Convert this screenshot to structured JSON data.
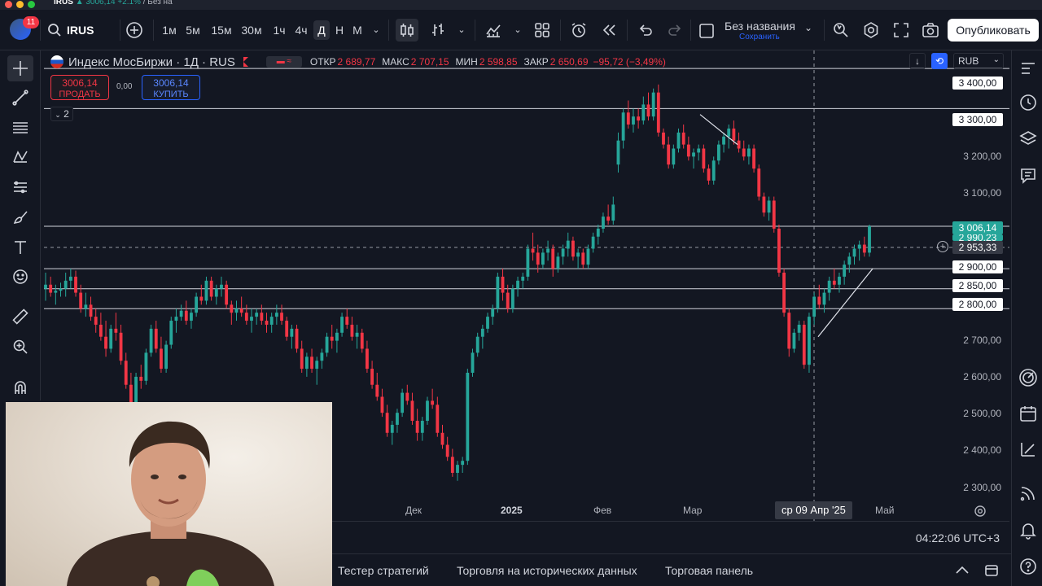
{
  "window": {
    "tab_symbol": "IRUS",
    "tab_price": "3006,14",
    "tab_change": "+2.1%",
    "tab_suffix": "/ Без на"
  },
  "toolbar": {
    "symbol": "IRUS",
    "notifications": "11",
    "intervals": [
      "1м",
      "5м",
      "15м",
      "30м",
      "1ч",
      "4ч",
      "Д",
      "Н",
      "М"
    ],
    "active_interval": "Д",
    "layout_name": "Без названия",
    "layout_save": "Сохранить",
    "publish_label": "Опубликовать"
  },
  "legend": {
    "name": "Индекс МосБиржи · 1Д · RUS",
    "open_label": "ОТКР",
    "open": "2 689,77",
    "high_label": "МАКС",
    "high": "2 707,15",
    "low_label": "МИН",
    "low": "2 598,85",
    "close_label": "ЗАКР",
    "close": "2 650,69",
    "change": "−95,72 (−3,49%)"
  },
  "trade": {
    "sell_price": "3006,14",
    "sell_label": "ПРОДАТЬ",
    "buy_price": "3006,14",
    "buy_label": "КУПИТЬ",
    "spread": "0,00",
    "indicators_count": "2"
  },
  "currency": "RUB",
  "price_axis": {
    "ticks": [
      "3 400,00",
      "3 300,00",
      "3 200,00",
      "3 100,00",
      "3 000,00",
      "2 900,00",
      "2 850,00",
      "2 800,00",
      "2 700,00",
      "2 600,00",
      "2 500,00",
      "2 400,00",
      "2 300,00"
    ],
    "last_price": "3 006,14",
    "last_price_hidden": "2 990,23",
    "crosshair_price": "2 953,33"
  },
  "time_axis": {
    "labels": [
      "Дек",
      "2025",
      "Фев",
      "Мар",
      "Май"
    ],
    "crosshair_date": "ср 09 Апр '25"
  },
  "clock": "04:22:06 UTC+3",
  "bottom_tabs": [
    "Тестер стратегий",
    "Торговля на исторических данных",
    "Торговая панель"
  ],
  "colors": {
    "up": "#26a69a",
    "down": "#f23645",
    "background": "#131722",
    "accent": "#2962ff"
  },
  "chart_data": {
    "type": "candlestick",
    "ylim": [
      2270,
      3445
    ],
    "horizontal_levels": [
      3400,
      3300,
      3006,
      2900,
      2850,
      2800
    ],
    "candles": [
      [
        2850,
        2890,
        2820,
        2860
      ],
      [
        2860,
        2880,
        2830,
        2840
      ],
      [
        2840,
        2860,
        2810,
        2845
      ],
      [
        2845,
        2865,
        2830,
        2850
      ],
      [
        2850,
        2890,
        2830,
        2870
      ],
      [
        2870,
        2900,
        2850,
        2880
      ],
      [
        2880,
        2895,
        2830,
        2840
      ],
      [
        2840,
        2860,
        2790,
        2800
      ],
      [
        2800,
        2840,
        2780,
        2810
      ],
      [
        2810,
        2830,
        2770,
        2780
      ],
      [
        2780,
        2800,
        2740,
        2760
      ],
      [
        2760,
        2790,
        2720,
        2730
      ],
      [
        2730,
        2770,
        2680,
        2700
      ],
      [
        2700,
        2760,
        2690,
        2750
      ],
      [
        2750,
        2790,
        2720,
        2740
      ],
      [
        2740,
        2760,
        2660,
        2670
      ],
      [
        2670,
        2690,
        2600,
        2610
      ],
      [
        2610,
        2640,
        2540,
        2560
      ],
      [
        2560,
        2640,
        2550,
        2630
      ],
      [
        2630,
        2660,
        2600,
        2620
      ],
      [
        2620,
        2700,
        2610,
        2690
      ],
      [
        2690,
        2760,
        2680,
        2750
      ],
      [
        2750,
        2770,
        2690,
        2700
      ],
      [
        2700,
        2730,
        2640,
        2650
      ],
      [
        2650,
        2720,
        2640,
        2710
      ],
      [
        2710,
        2780,
        2700,
        2770
      ],
      [
        2770,
        2800,
        2740,
        2780
      ],
      [
        2780,
        2810,
        2770,
        2795
      ],
      [
        2795,
        2820,
        2760,
        2770
      ],
      [
        2770,
        2800,
        2750,
        2790
      ],
      [
        2790,
        2840,
        2780,
        2830
      ],
      [
        2830,
        2860,
        2810,
        2820
      ],
      [
        2820,
        2880,
        2810,
        2870
      ],
      [
        2870,
        2880,
        2820,
        2830
      ],
      [
        2830,
        2860,
        2810,
        2850
      ],
      [
        2850,
        2880,
        2830,
        2860
      ],
      [
        2860,
        2870,
        2800,
        2810
      ],
      [
        2810,
        2820,
        2760,
        2790
      ],
      [
        2790,
        2820,
        2770,
        2800
      ],
      [
        2800,
        2830,
        2780,
        2790
      ],
      [
        2790,
        2810,
        2760,
        2770
      ],
      [
        2770,
        2800,
        2740,
        2780
      ],
      [
        2780,
        2800,
        2760,
        2790
      ],
      [
        2790,
        2810,
        2760,
        2770
      ],
      [
        2770,
        2790,
        2740,
        2760
      ],
      [
        2760,
        2790,
        2740,
        2780
      ],
      [
        2780,
        2810,
        2760,
        2790
      ],
      [
        2790,
        2810,
        2760,
        2770
      ],
      [
        2770,
        2780,
        2720,
        2730
      ],
      [
        2730,
        2760,
        2700,
        2750
      ],
      [
        2750,
        2760,
        2690,
        2700
      ],
      [
        2700,
        2720,
        2640,
        2650
      ],
      [
        2650,
        2690,
        2630,
        2680
      ],
      [
        2680,
        2700,
        2640,
        2650
      ],
      [
        2650,
        2680,
        2610,
        2670
      ],
      [
        2670,
        2700,
        2650,
        2690
      ],
      [
        2690,
        2740,
        2680,
        2730
      ],
      [
        2730,
        2760,
        2700,
        2720
      ],
      [
        2720,
        2750,
        2690,
        2740
      ],
      [
        2740,
        2790,
        2730,
        2780
      ],
      [
        2780,
        2800,
        2750,
        2760
      ],
      [
        2760,
        2780,
        2720,
        2730
      ],
      [
        2730,
        2760,
        2700,
        2740
      ],
      [
        2740,
        2750,
        2690,
        2700
      ],
      [
        2700,
        2720,
        2640,
        2650
      ],
      [
        2650,
        2670,
        2600,
        2610
      ],
      [
        2610,
        2640,
        2570,
        2580
      ],
      [
        2580,
        2600,
        2530,
        2540
      ],
      [
        2540,
        2560,
        2480,
        2490
      ],
      [
        2490,
        2520,
        2460,
        2510
      ],
      [
        2510,
        2550,
        2490,
        2540
      ],
      [
        2540,
        2600,
        2530,
        2590
      ],
      [
        2590,
        2610,
        2560,
        2570
      ],
      [
        2570,
        2590,
        2510,
        2520
      ],
      [
        2520,
        2550,
        2470,
        2490
      ],
      [
        2490,
        2530,
        2470,
        2520
      ],
      [
        2520,
        2580,
        2510,
        2570
      ],
      [
        2570,
        2600,
        2550,
        2560
      ],
      [
        2560,
        2580,
        2480,
        2490
      ],
      [
        2490,
        2510,
        2450,
        2460
      ],
      [
        2460,
        2480,
        2420,
        2430
      ],
      [
        2430,
        2450,
        2380,
        2390
      ],
      [
        2390,
        2420,
        2370,
        2410
      ],
      [
        2410,
        2430,
        2390,
        2420
      ],
      [
        2420,
        2650,
        2410,
        2640
      ],
      [
        2640,
        2700,
        2630,
        2690
      ],
      [
        2690,
        2740,
        2680,
        2730
      ],
      [
        2730,
        2760,
        2700,
        2750
      ],
      [
        2750,
        2790,
        2740,
        2780
      ],
      [
        2780,
        2810,
        2760,
        2800
      ],
      [
        2800,
        2890,
        2790,
        2880
      ],
      [
        2880,
        2900,
        2820,
        2840
      ],
      [
        2840,
        2860,
        2790,
        2800
      ],
      [
        2800,
        2860,
        2790,
        2850
      ],
      [
        2850,
        2880,
        2830,
        2870
      ],
      [
        2870,
        2890,
        2850,
        2880
      ],
      [
        2880,
        2960,
        2870,
        2950
      ],
      [
        2950,
        2990,
        2920,
        2940
      ],
      [
        2940,
        2960,
        2890,
        2910
      ],
      [
        2910,
        2950,
        2900,
        2940
      ],
      [
        2940,
        2970,
        2920,
        2950
      ],
      [
        2950,
        2960,
        2880,
        2900
      ],
      [
        2900,
        2940,
        2890,
        2930
      ],
      [
        2930,
        2960,
        2910,
        2950
      ],
      [
        2950,
        2990,
        2930,
        2970
      ],
      [
        2970,
        2980,
        2920,
        2930
      ],
      [
        2930,
        2950,
        2900,
        2940
      ],
      [
        2940,
        2950,
        2900,
        2910
      ],
      [
        2910,
        2960,
        2900,
        2950
      ],
      [
        2950,
        2990,
        2940,
        2980
      ],
      [
        2980,
        3010,
        2960,
        3000
      ],
      [
        3000,
        3040,
        2990,
        3030
      ],
      [
        3030,
        3060,
        3010,
        3020
      ],
      [
        3020,
        3080,
        3010,
        3060
      ],
      [
        3160,
        3240,
        3140,
        3220
      ],
      [
        3220,
        3300,
        3200,
        3290
      ],
      [
        3290,
        3320,
        3250,
        3260
      ],
      [
        3260,
        3300,
        3240,
        3280
      ],
      [
        3280,
        3300,
        3250,
        3270
      ],
      [
        3270,
        3330,
        3260,
        3310
      ],
      [
        3310,
        3340,
        3270,
        3280
      ],
      [
        3280,
        3350,
        3270,
        3340
      ],
      [
        3340,
        3360,
        3230,
        3240
      ],
      [
        3240,
        3250,
        3200,
        3210
      ],
      [
        3210,
        3230,
        3150,
        3160
      ],
      [
        3160,
        3210,
        3150,
        3200
      ],
      [
        3200,
        3250,
        3190,
        3240
      ],
      [
        3240,
        3260,
        3200,
        3210
      ],
      [
        3210,
        3230,
        3170,
        3180
      ],
      [
        3180,
        3200,
        3150,
        3190
      ],
      [
        3190,
        3210,
        3170,
        3200
      ],
      [
        3200,
        3210,
        3140,
        3150
      ],
      [
        3150,
        3160,
        3110,
        3120
      ],
      [
        3120,
        3180,
        3110,
        3170
      ],
      [
        3170,
        3220,
        3160,
        3210
      ],
      [
        3210,
        3240,
        3190,
        3230
      ],
      [
        3230,
        3260,
        3200,
        3250
      ],
      [
        3250,
        3270,
        3210,
        3220
      ],
      [
        3220,
        3240,
        3190,
        3200
      ],
      [
        3200,
        3220,
        3170,
        3180
      ],
      [
        3180,
        3210,
        3160,
        3200
      ],
      [
        3200,
        3210,
        3140,
        3150
      ],
      [
        3150,
        3160,
        3070,
        3080
      ],
      [
        3080,
        3090,
        3030,
        3040
      ],
      [
        3040,
        3080,
        3020,
        3070
      ],
      [
        3070,
        3080,
        2990,
        3000
      ],
      [
        3000,
        3010,
        2880,
        2890
      ],
      [
        2890,
        2900,
        2780,
        2790
      ],
      [
        2790,
        2800,
        2680,
        2700
      ],
      [
        2700,
        2750,
        2690,
        2740
      ],
      [
        2740,
        2770,
        2720,
        2760
      ],
      [
        2760,
        2770,
        2650,
        2660
      ],
      [
        2660,
        2790,
        2640,
        2780
      ],
      [
        2780,
        2840,
        2760,
        2830
      ],
      [
        2830,
        2860,
        2800,
        2810
      ],
      [
        2810,
        2850,
        2790,
        2840
      ],
      [
        2840,
        2880,
        2820,
        2870
      ],
      [
        2870,
        2900,
        2850,
        2860
      ],
      [
        2860,
        2890,
        2840,
        2880
      ],
      [
        2880,
        2920,
        2860,
        2910
      ],
      [
        2910,
        2940,
        2890,
        2930
      ],
      [
        2930,
        2960,
        2910,
        2950
      ],
      [
        2950,
        2970,
        2920,
        2960
      ],
      [
        2960,
        2980,
        2930,
        2940
      ],
      [
        2940,
        3010,
        2930,
        3006
      ]
    ],
    "trendlines": [
      {
        "from": [
          "Мар",
          "3280"
        ],
        "to": [
          "Мар",
          "3215"
        ]
      },
      {
        "from": [
          "Апр",
          "2720"
        ],
        "to": [
          "Апр",
          "2900"
        ]
      }
    ]
  }
}
